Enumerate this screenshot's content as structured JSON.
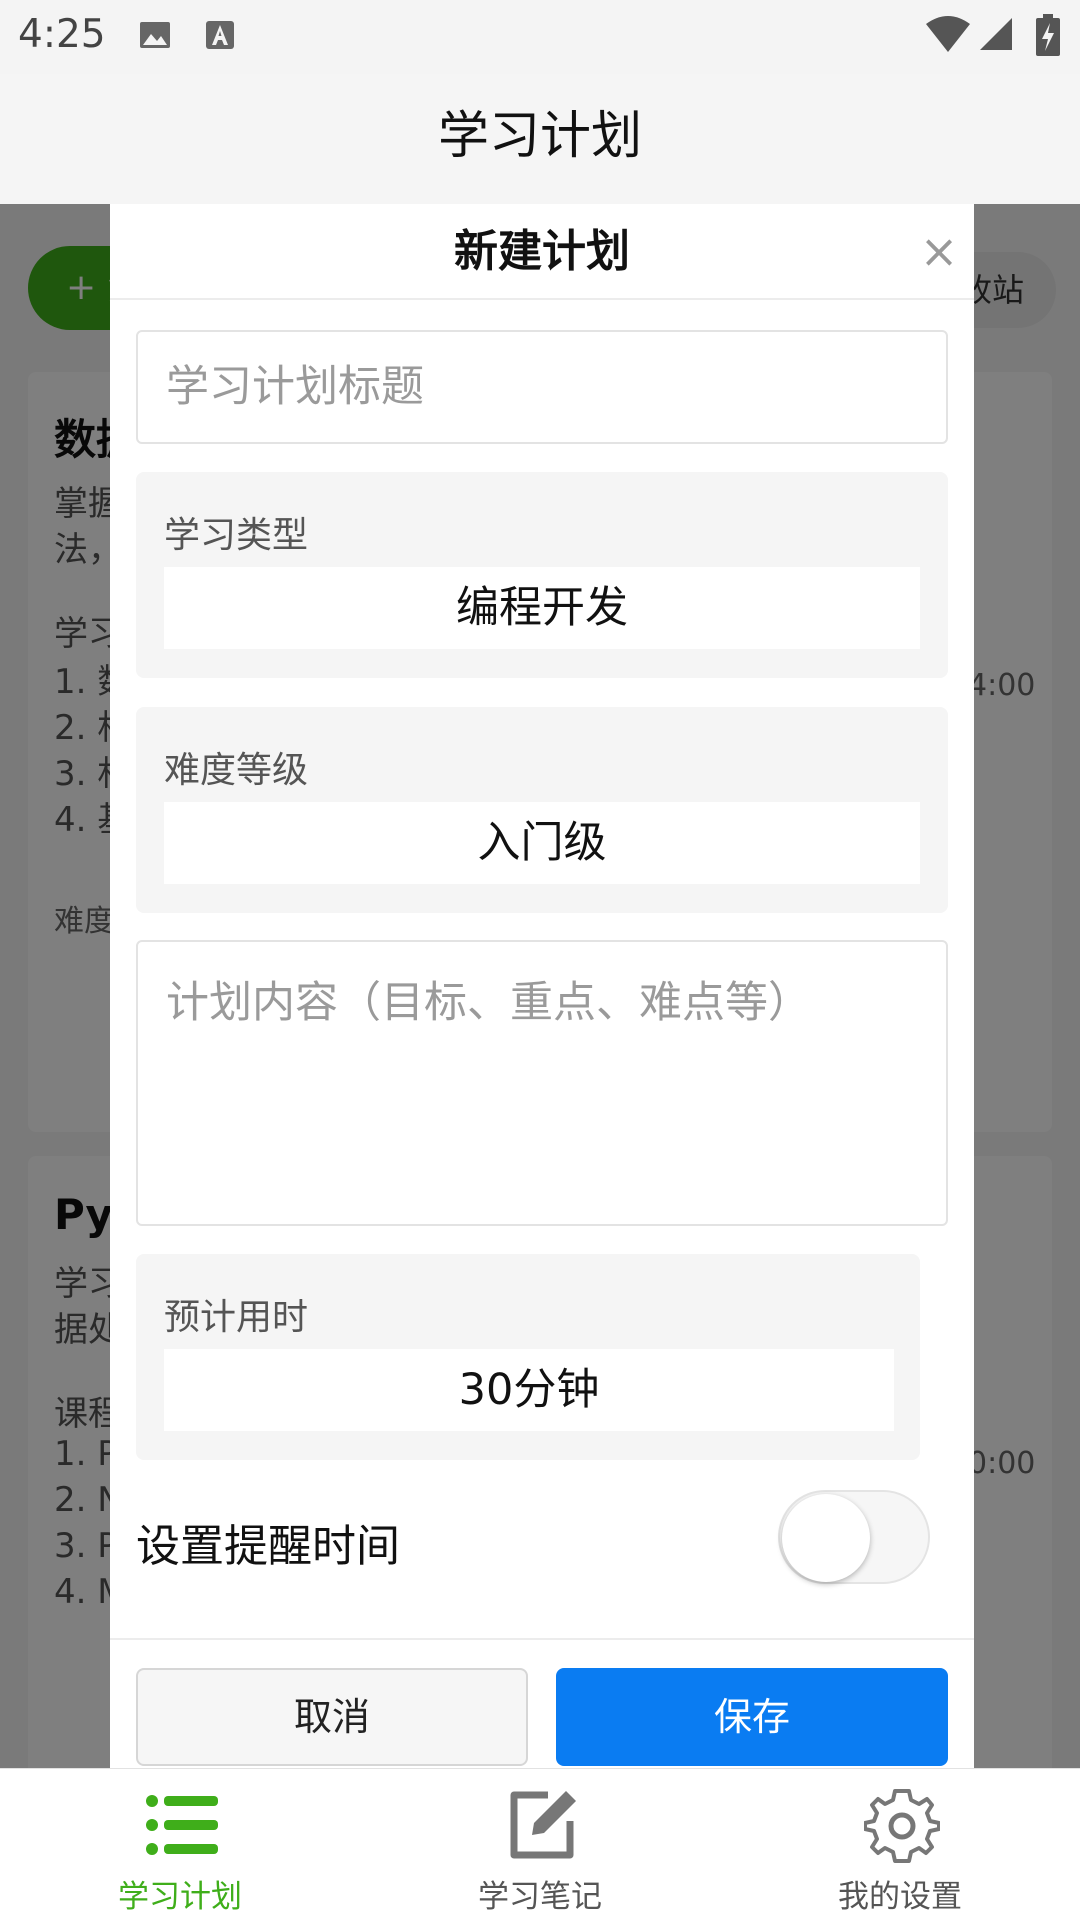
{
  "status_bar": {
    "time": "4:25"
  },
  "header": {
    "title": "学习计划"
  },
  "background": {
    "add_label": "+ 添加计划",
    "recycle_label": "回收站",
    "cards": [
      {
        "title": "数据",
        "lines": [
          "掌握",
          "法，",
          "学习",
          "1. 数",
          "2. 相",
          "3. 村",
          "4. 基"
        ],
        "meta_left": "难度",
        "meta_right": "4:00"
      },
      {
        "title": "Pyt",
        "lines": [
          "学习",
          "据处",
          "课程",
          "1. P",
          "2. N",
          "3. P",
          "4. M"
        ],
        "meta_right": "0:00"
      }
    ]
  },
  "modal": {
    "title": "新建计划",
    "close_symbol": "×",
    "title_input": {
      "value": "",
      "placeholder": "学习计划标题"
    },
    "type_picker": {
      "label": "学习类型",
      "value": "编程开发"
    },
    "level_picker": {
      "label": "难度等级",
      "value": "入门级"
    },
    "content_input": {
      "value": "",
      "placeholder": "计划内容（目标、重点、难点等）"
    },
    "time_picker": {
      "label": "预计用时",
      "value": "30分钟"
    },
    "reminder": {
      "label": "设置提醒时间",
      "enabled": false
    },
    "cancel_label": "取消",
    "save_label": "保存"
  },
  "nav": {
    "items": [
      {
        "label": "学习计划",
        "icon": "list-icon",
        "active": true
      },
      {
        "label": "学习笔记",
        "icon": "edit-note-icon",
        "active": false
      },
      {
        "label": "我的设置",
        "icon": "gear-icon",
        "active": false
      }
    ]
  },
  "colors": {
    "accent_green": "#3fae1a",
    "primary_blue": "#0a7cf2",
    "overlay": "rgba(0,0,0,0.5)"
  }
}
